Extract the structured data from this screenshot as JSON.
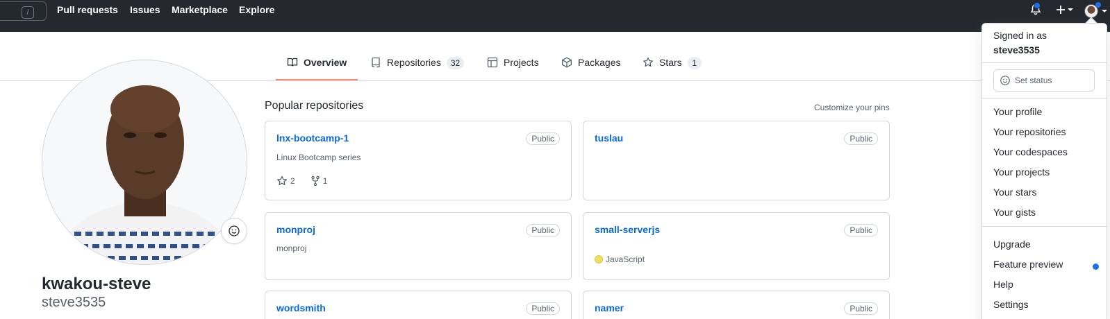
{
  "header": {
    "search_shortcut": "/",
    "nav": [
      "Pull requests",
      "Issues",
      "Marketplace",
      "Explore"
    ]
  },
  "tabs": {
    "overview": "Overview",
    "repositories": "Repositories",
    "repositories_count": "32",
    "projects": "Projects",
    "packages": "Packages",
    "stars": "Stars",
    "stars_count": "1"
  },
  "profile": {
    "full_name": "kwakou-steve",
    "username": "steve3535"
  },
  "pinned": {
    "title": "Popular repositories",
    "customize": "Customize your pins",
    "repos": [
      {
        "name": "lnx-bootcamp-1",
        "visibility": "Public",
        "description": "Linux Bootcamp series",
        "stars": "2",
        "forks": "1"
      },
      {
        "name": "tuslau",
        "visibility": "Public"
      },
      {
        "name": "monproj",
        "visibility": "Public",
        "description": "monproj"
      },
      {
        "name": "small-serverjs",
        "visibility": "Public",
        "language": "JavaScript",
        "language_color": "#f1e05a"
      },
      {
        "name": "wordsmith",
        "visibility": "Public"
      },
      {
        "name": "namer",
        "visibility": "Public"
      }
    ]
  },
  "menu": {
    "signed_in_as": "Signed in as",
    "user": "steve3535",
    "set_status": "Set status",
    "items": [
      "Your profile",
      "Your repositories",
      "Your codespaces",
      "Your projects",
      "Your stars",
      "Your gists"
    ],
    "items2": [
      "Upgrade",
      "Feature preview",
      "Help",
      "Settings"
    ]
  },
  "colors": {
    "header_bg": "#24292f",
    "link": "#0969da",
    "accent": "#1f6feb",
    "tab_underline": "#fd8c73"
  }
}
